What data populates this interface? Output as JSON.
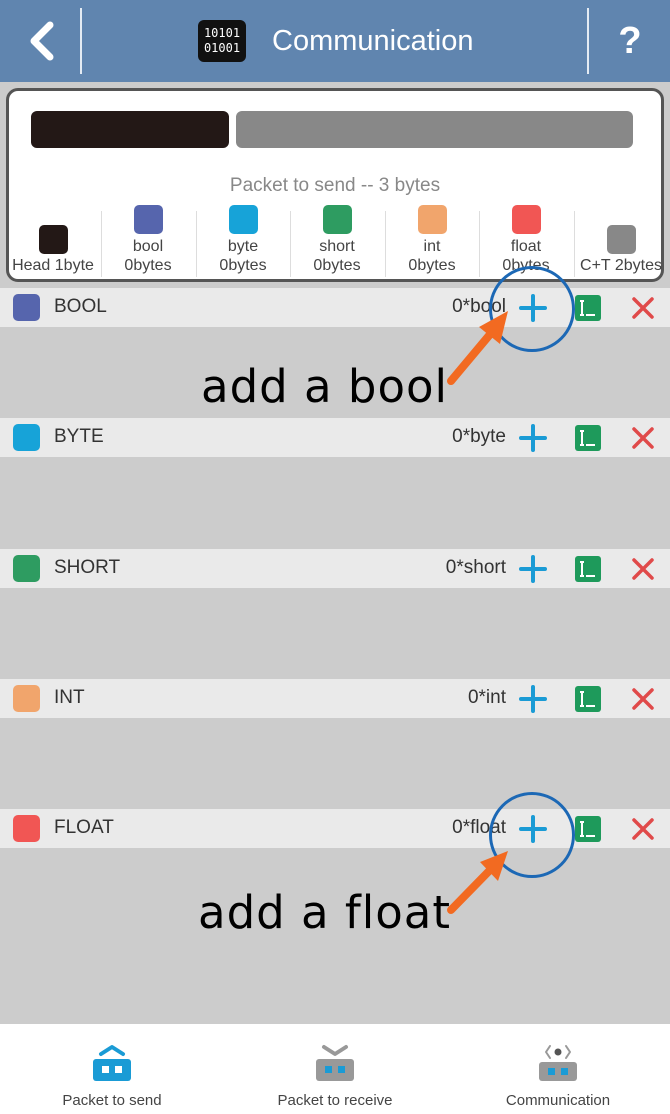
{
  "header": {
    "title": "Communication",
    "logo_line1": "10101",
    "logo_line2": "01001",
    "help_label": "?"
  },
  "packet": {
    "caption": "Packet to send -- 3 bytes",
    "legend": [
      {
        "name": "Head 1byte",
        "color": "#231816"
      },
      {
        "name": "bool",
        "size": "0bytes",
        "color": "#5665ad"
      },
      {
        "name": "byte",
        "size": "0bytes",
        "color": "#17a3d8"
      },
      {
        "name": "short",
        "size": "0bytes",
        "color": "#2e9c61"
      },
      {
        "name": "int",
        "size": "0bytes",
        "color": "#f1a56c"
      },
      {
        "name": "float",
        "size": "0bytes",
        "color": "#f15654"
      },
      {
        "name": "C+T 2bytes",
        "color": "#888888"
      }
    ]
  },
  "sections": [
    {
      "label": "BOOL",
      "count": "0*bool",
      "color": "#5665ad"
    },
    {
      "label": "BYTE",
      "count": "0*byte",
      "color": "#17a3d8"
    },
    {
      "label": "SHORT",
      "count": "0*short",
      "color": "#2e9c61"
    },
    {
      "label": "INT",
      "count": "0*int",
      "color": "#f1a56c"
    },
    {
      "label": "FLOAT",
      "count": "0*float",
      "color": "#f15654"
    }
  ],
  "annotations": {
    "bool": "add a bool",
    "float": "add a float"
  },
  "nav": [
    {
      "label": "Packet to send",
      "icon": "packet-send-icon",
      "active": true
    },
    {
      "label": "Packet to receive",
      "icon": "packet-receive-icon",
      "active": false
    },
    {
      "label": "Communication",
      "icon": "communication-icon",
      "active": false
    }
  ],
  "colors": {
    "header": "#6085af",
    "accent": "#1a9bd5",
    "delete": "#e04a4a",
    "list": "#1e9a5b",
    "annotation_circle": "#1c68b5",
    "annotation_arrow": "#f26a21"
  }
}
